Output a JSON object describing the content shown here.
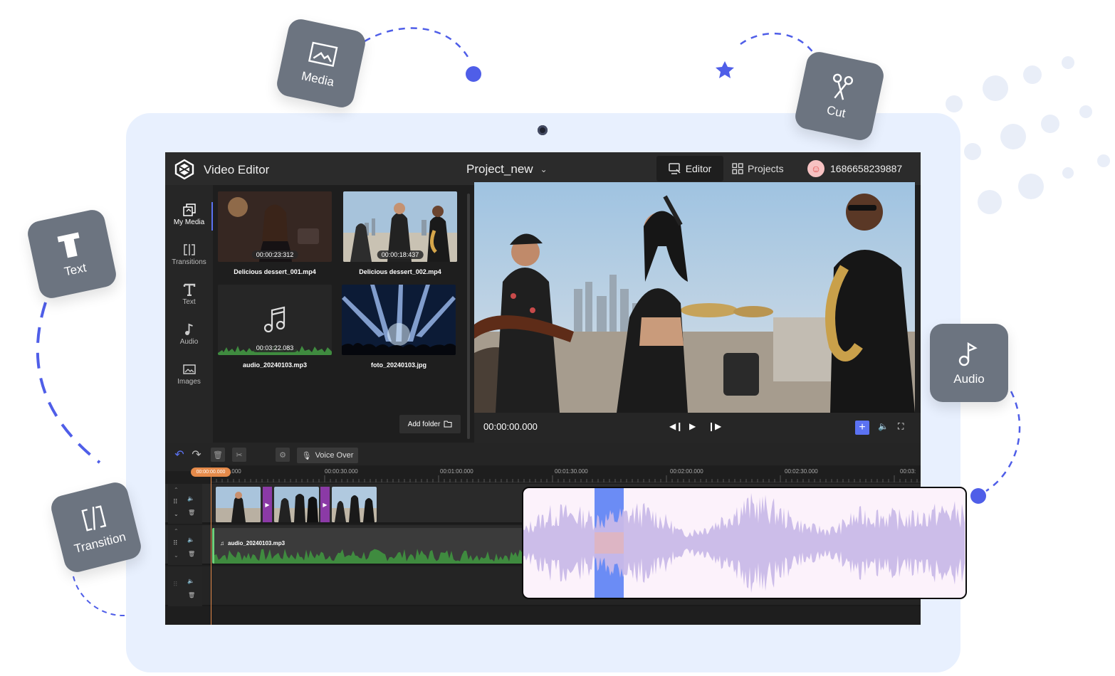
{
  "app": {
    "title": "Video Editor",
    "project_name": "Project_new",
    "user_id": "1686658239887"
  },
  "nav": {
    "editor_label": "Editor",
    "projects_label": "Projects"
  },
  "sidebar": {
    "items": [
      {
        "label": "My Media",
        "icon": "media-stack-icon",
        "active": true
      },
      {
        "label": "Transitions",
        "icon": "transition-icon"
      },
      {
        "label": "Text",
        "icon": "text-icon"
      },
      {
        "label": "Audio",
        "icon": "music-note-icon"
      },
      {
        "label": "Images",
        "icon": "image-icon"
      }
    ]
  },
  "media": {
    "items": [
      {
        "name": "Delicious dessert_001.mp4",
        "duration": "00:00:23:312"
      },
      {
        "name": "Delicious dessert_002.mp4",
        "duration": "00:00:18:437"
      },
      {
        "name": "audio_20240103.mp3",
        "duration": "00:03:22.083"
      },
      {
        "name": "foto_20240103.jpg",
        "duration": ""
      }
    ],
    "add_folder_label": "Add folder"
  },
  "player": {
    "timecode": "00:00:00.000"
  },
  "timeline": {
    "voice_over_label": "Voice Over",
    "playhead_time": "00:00:00.000",
    "ruler_marks": [
      "00:00:00.000",
      "00:00:30.000",
      "00:01:00.000",
      "00:01:30.000",
      "00:02:00.000",
      "00:02:30.000",
      "00:03:"
    ],
    "audio_clip_name": "audio_20240103.mp3"
  },
  "features": {
    "media": "Media",
    "cut": "Cut",
    "text": "Text",
    "audio": "Audio",
    "transition": "Transition"
  },
  "colors": {
    "accent": "#5b72f2",
    "card_gray": "#6c7480",
    "tablet_bg": "#e8f0fe",
    "waveform": "#c9b9e8",
    "playhead": "#e58a4a"
  }
}
